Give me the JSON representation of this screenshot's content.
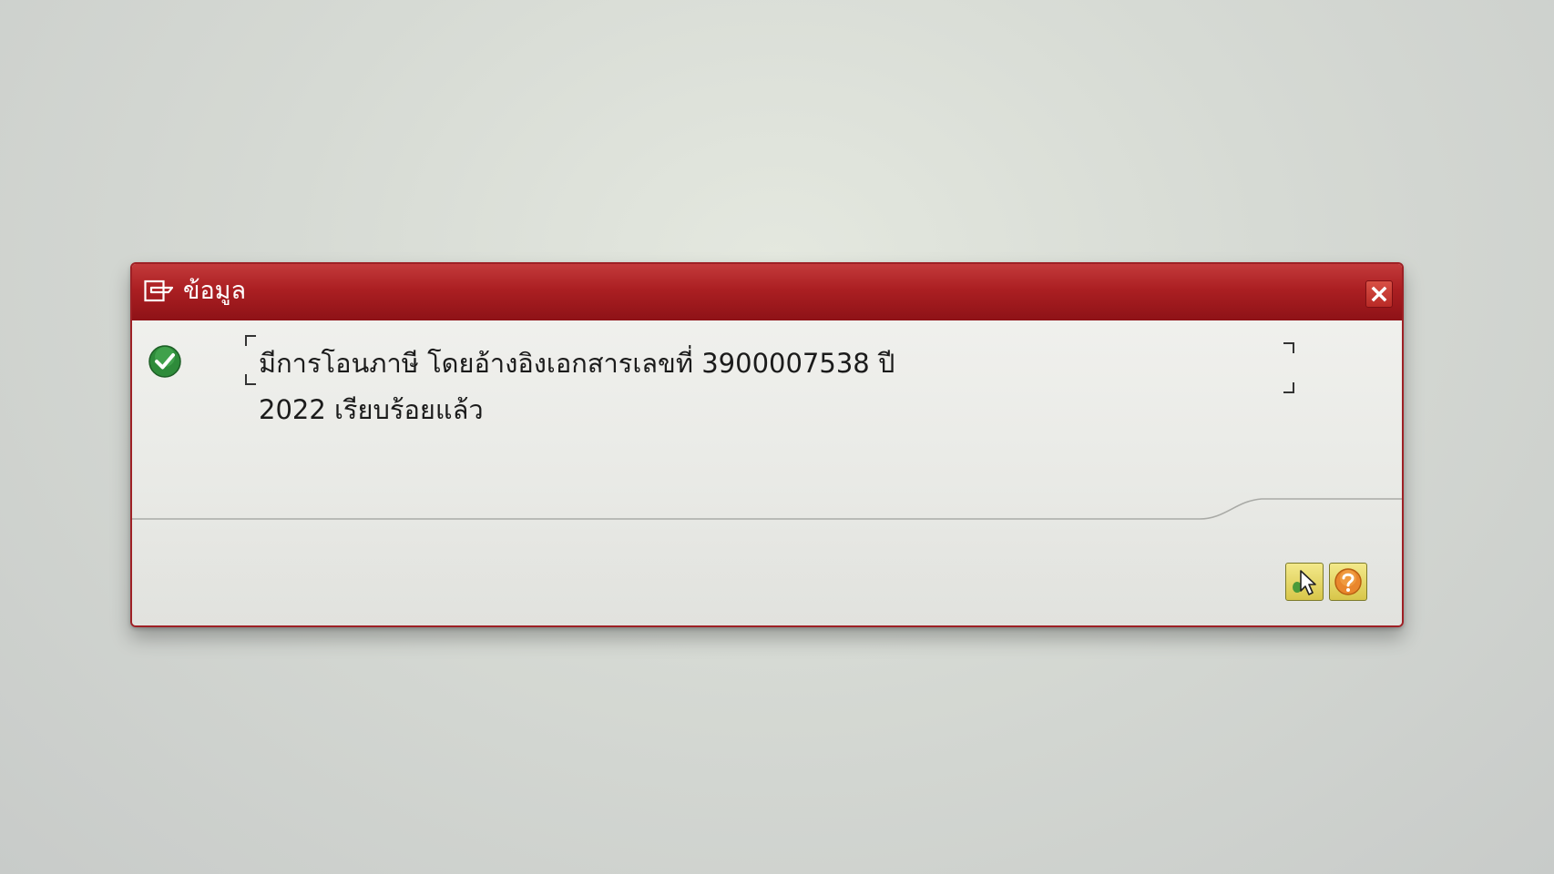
{
  "dialog": {
    "title": "ข้อมูล",
    "title_icon": "message-window-icon",
    "close_icon": "close-icon",
    "status_icon": "success-check-icon",
    "message_line1": "มีการโอนภาษี โดยอ้างอิงเอกสารเลขที่ 3900007538 ปี",
    "message_line2": "2022 เรียบร้อยแล้ว",
    "buttons": [
      {
        "icon": "continue-pointer-icon"
      },
      {
        "icon": "help-question-icon"
      }
    ]
  },
  "colors": {
    "titlebar": "#ab1f22",
    "success": "#2e8b3a",
    "button_yellow": "#e6d764"
  }
}
